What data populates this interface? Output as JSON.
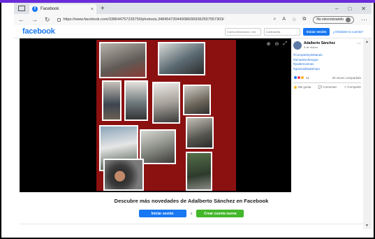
{
  "browser": {
    "tab_title": "Facebook",
    "tab_close": "×",
    "new_tab": "+",
    "url": "https://www.facebook.com/338644757235750/photos/a.348454730449086/969362557557303/",
    "incognito_label": "No sincronizando",
    "win_min": "–",
    "win_max": "□",
    "win_close": "✕"
  },
  "header": {
    "logo": "facebook",
    "email_placeholder": "Correo electrónico o tel.",
    "password_placeholder": "Contraseña",
    "login_button": "Iniciar sesión",
    "forgot_link": "¿Olvidaste la cuenta?"
  },
  "post": {
    "author": "Adalberto Sánchez",
    "time": "3 de marzo",
    "tags": [
      "#CompartirySEtando",
      "#amadoschengue",
      "#podemosmas",
      "#graciasblaatempo"
    ],
    "reaction_count": "31",
    "share_count": "20 veces compartido",
    "like_label": "Me gusta",
    "comment_label": "Comentar",
    "share_label": "Compartir"
  },
  "banner": {
    "title": "Descubre más novedades de Adalberto Sánchez en Facebook",
    "login_button": "Iniciar sesión",
    "separator": "o",
    "signup_button": "Crear cuenta nueva"
  },
  "colors": {
    "brand_blue": "#1877f2",
    "signup_green": "#42b72a",
    "frame_purple": "#6a2bd8"
  }
}
